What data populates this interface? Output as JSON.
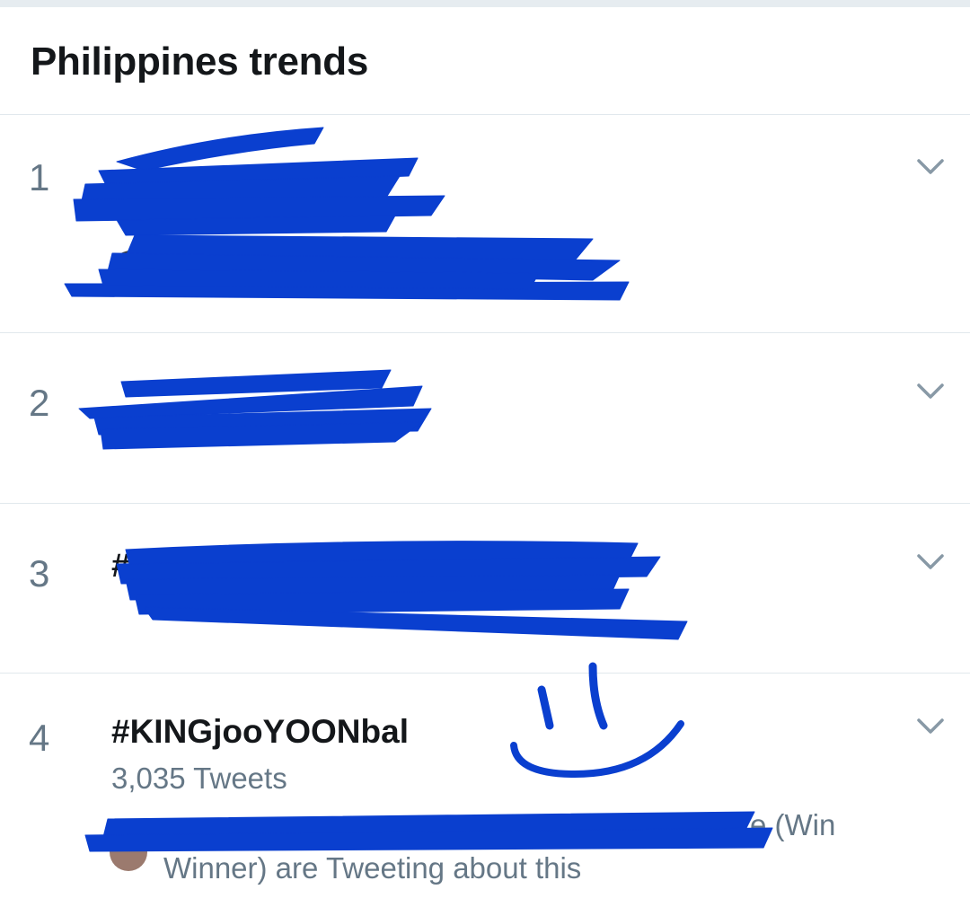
{
  "header": {
    "title": "Philippines trends"
  },
  "trends": [
    {
      "rank": "1"
    },
    {
      "rank": "2"
    },
    {
      "rank": "3",
      "name_partial": "#T"
    },
    {
      "rank": "4",
      "name": "#KINGjooYOONbal",
      "tweet_count": "3,035 Tweets",
      "context_line1_tail": "e (Win",
      "context_line2": "Winner) are Tweeting about this"
    }
  ],
  "icons": {
    "chevron": "chevron-down-icon"
  },
  "colors": {
    "redaction": "#0a3fcf",
    "muted": "#657786",
    "divider": "#e1e8ed"
  }
}
